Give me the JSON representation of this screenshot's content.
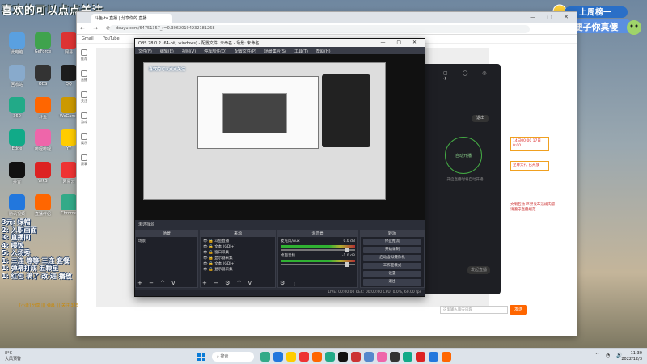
{
  "overlay": {
    "title": "喜欢的可以点点关注",
    "badge_line1": "上周榜一",
    "badge_line2": "便子你真傻",
    "mini_title": "喜欢的可以点点关注",
    "list": [
      "3元: 绿帽",
      "2: 入职画面",
      "3: 直播间",
      "4: 喂饭",
      "5: 入场秀",
      "1: 三连 等等 三连 套餐",
      "1: 弹幕打成 五颗星",
      "1: 红包 满了 改 进 播放"
    ]
  },
  "desktop_icons": [
    {
      "label": "此电脑",
      "color": "#5aa0e0"
    },
    {
      "label": "GeForce",
      "color": "#3fa34d"
    },
    {
      "label": "网易",
      "color": "#d33"
    },
    {
      "label": "回收站",
      "color": "#8ac"
    },
    {
      "label": "OBS",
      "color": "#333"
    },
    {
      "label": "QQ",
      "color": "#1c1c1c"
    },
    {
      "label": "360",
      "color": "#2a8"
    },
    {
      "label": "斗鱼",
      "color": "#f60"
    },
    {
      "label": "WeGame",
      "color": "#c90"
    },
    {
      "label": "Edge",
      "color": "#1a8"
    },
    {
      "label": "哔哩哔哩",
      "color": "#e6a"
    },
    {
      "label": "YY",
      "color": "#fc0"
    },
    {
      "label": "抖音",
      "color": "#111"
    },
    {
      "label": "WPS",
      "color": "#d22"
    },
    {
      "label": "网易云",
      "color": "#e33"
    },
    {
      "label": "腾讯视频",
      "color": "#27d"
    },
    {
      "label": "直播伴侣",
      "color": "#f60"
    },
    {
      "label": "Chrome",
      "color": "#3a8"
    }
  ],
  "browser": {
    "tab_title": "斗鱼·tv 直播 | 分享你的 直播",
    "url": "douyu.com/64751357_r=0.30620194932181268",
    "bookmarks": [
      "Gmail",
      "YouTube"
    ],
    "sidebar": [
      "推荐",
      "直播",
      "关注",
      "游戏",
      "娱乐",
      "赛事"
    ]
  },
  "obs": {
    "title": "OBS 28.0.2 (64-bit, windows) - 配置文件: 未命名 - 场景: 未命名",
    "menu": [
      "文件(F)",
      "编辑(E)",
      "视图(V)",
      "停靠部件(D)",
      "配置文件(P)",
      "场景集合(S)",
      "工具(T)",
      "帮助(H)"
    ],
    "status_strip": "未选择源",
    "docks": {
      "scenes": {
        "header": "场景",
        "items": [
          "场景"
        ]
      },
      "sources": {
        "header": "来源",
        "items": [
          "斗鱼直播",
          "文本 (GDI+)",
          "窗口采集",
          "显示器采集",
          "文本 (GDI+)",
          "显示器采集"
        ]
      },
      "mixer": {
        "header": "混音器",
        "ch1": "麦克风/Aux",
        "ch1_val": "0.0 dB",
        "ch2": "桌面音频",
        "ch2_val": "-1.0 dB"
      },
      "transitions": {
        "header": "转场"
      },
      "controls": {
        "header": "控件",
        "buttons": [
          "停止推流",
          "开始录制",
          "启动虚拟摄像机",
          "工作室模式",
          "设置",
          "退出"
        ]
      }
    },
    "footer": "LIVE: 00:00:00   REC: 00:00:00   CPU: 0.0%, 60.00 fps"
  },
  "mobile_panel": {
    "circle_label": "自动开播",
    "top_btn": "退出",
    "caption": "开启直播时将自动开播",
    "bottom_btn": "发起直播"
  },
  "right_panel": {
    "box1": "14日00:00 17日0:00",
    "box2": "至尊大礼 已开放",
    "text": "文明互动 严禁发布违规内容 请遵守直播规范"
  },
  "chat": {
    "bar": "[小录] 分享 ||| 弹幕 ||| 关注 345",
    "input_placeholder": "这里输入聊天内容",
    "send": "发送"
  },
  "taskbar": {
    "weather_temp": "8°C",
    "weather_desc": "大风预警",
    "search": "搜索",
    "time": "11:30",
    "date": "2022/12/3",
    "icon_colors": [
      "#3a8",
      "#27d",
      "#fc0",
      "#e33",
      "#f60",
      "#2a8",
      "#111",
      "#c33",
      "#58c",
      "#e6a",
      "#333",
      "#1a8",
      "#d22",
      "#27d",
      "#f60"
    ]
  }
}
